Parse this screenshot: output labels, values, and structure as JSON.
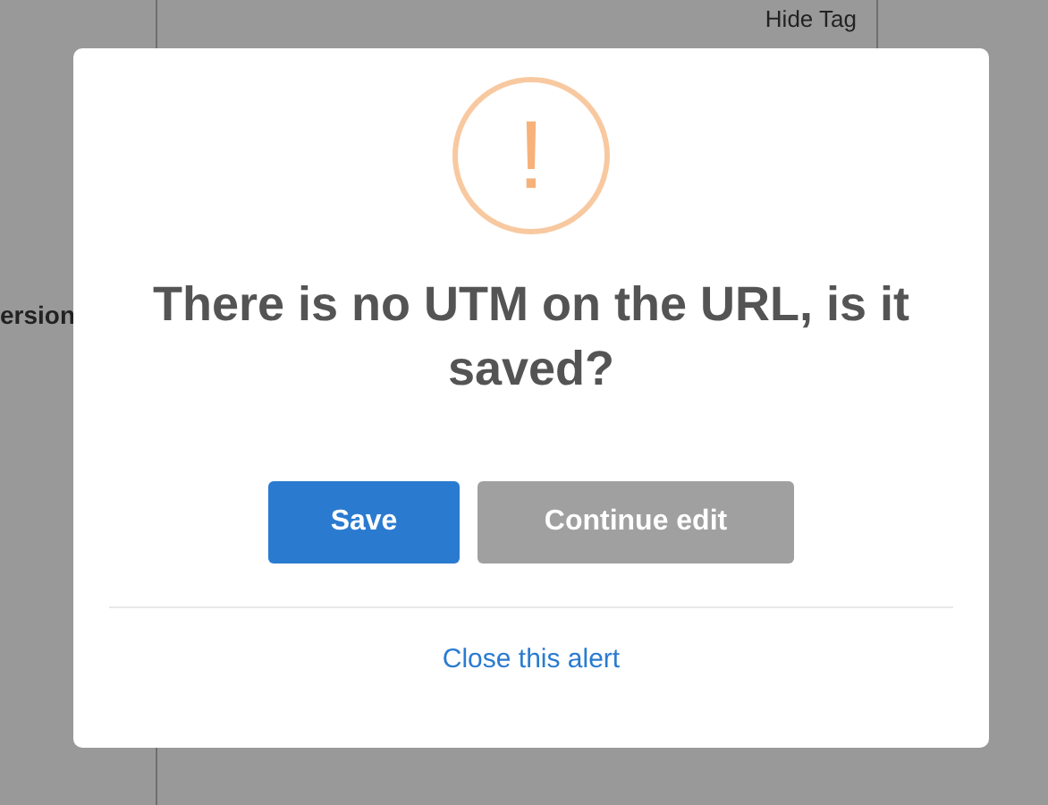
{
  "background": {
    "tag_toggle": "Hide Tag",
    "side_label": "ersion"
  },
  "alert": {
    "icon_glyph": "!",
    "message": "There is no UTM on the URL, is it saved?",
    "buttons": [
      {
        "label": "Save",
        "kind": "primary"
      },
      {
        "label": "Continue edit",
        "kind": "secondary"
      }
    ],
    "close_link": "Close this alert"
  }
}
